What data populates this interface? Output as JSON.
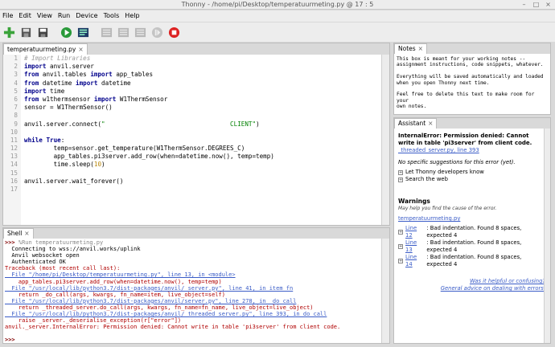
{
  "window": {
    "title": "Thonny  -  /home/pi/Desktop/temperatuurmeting.py  @  17 : 5",
    "controls": [
      "–",
      "□",
      "×"
    ]
  },
  "menu": [
    "File",
    "Edit",
    "View",
    "Run",
    "Device",
    "Tools",
    "Help"
  ],
  "toolbar": {
    "icons": [
      "new-file-icon",
      "open-file-icon",
      "save-file-icon",
      "run-icon",
      "debug-icon",
      "step-over-icon",
      "step-into-icon",
      "step-out-icon",
      "resume-icon",
      "stop-icon"
    ]
  },
  "editor": {
    "tab_label": "temperatuurmeting.py",
    "tab_close": "×",
    "line_numbers": [
      "1",
      "2",
      "3",
      "4",
      "5",
      "6",
      "7",
      "8",
      "9",
      "10",
      "11",
      "12",
      "13",
      "14",
      "15",
      "16",
      "17"
    ]
  },
  "shell": {
    "tab_label": "Shell",
    "tab_close": "×",
    "command_prompt": ">>>",
    "command": " %Run temperatuurmeting.py",
    "output": [
      "  Connecting to wss://anvil.works/uplink",
      "  Anvil websocket open",
      "  Authenticated OK"
    ],
    "traceback_header": "Traceback (most recent call last):",
    "trace": [
      {
        "file": "  File \"/home/pi/Desktop/temperatuurmeting.py\", line 13, in <module>",
        "code": "    app_tables.pi3server.add_row(when=datetime.now(), temp=temp)"
      },
      {
        "file": "  File \"/usr/local/lib/python3.7/dist-packages/anvil/_server.py\", line 41, in item_fn",
        "code": "    return _do_call(args, kwargs, fn_name=item, live_object=self)"
      },
      {
        "file": "  File \"/usr/local/lib/python3.7/dist-packages/anvil/server.py\", line 278, in _do_call",
        "code": "    return _threaded_server.do_call(args, kwargs, fn_name=fn_name, live_object=live_object)"
      },
      {
        "file": "  File \"/usr/local/lib/python3.7/dist-packages/anvil/_threaded_server.py\", line 393, in do_call",
        "code": "    raise _server._deserialise_exception(r[\"error\"])"
      }
    ],
    "error_line": "anvil._server.InternalError: Permission denied: Cannot write in table 'pi3server' from client code.",
    "final_prompt": ">>>"
  },
  "notes": {
    "tab_label": "Notes",
    "tab_close": "×",
    "lines": [
      "This box is meant for your working notes --",
      "assignment instructions, code snippets, whatever.",
      "",
      "Everything will be saved automatically and loaded",
      "when you open Thonny next time.",
      "",
      "Feel free to delete this text to make room for your",
      "own notes."
    ]
  },
  "assistant": {
    "tab_label": "Assistant",
    "tab_close": "×",
    "error_title": "InternalError: Permission denied: Cannot write in table 'pi3server' from client code.",
    "error_link": "_threaded_server.py, line 393",
    "no_suggestions": "No specific suggestions for this error (yet).",
    "options": [
      "Let Thonny developers know",
      "Search the web"
    ],
    "warnings_heading": "Warnings",
    "warnings_sub": "May help you find the cause of the error.",
    "file_link": "temperatuurmeting.py",
    "warnings": [
      {
        "link": "Line 12",
        "text": ": Bad indentation. Found 8 spaces, expected 4"
      },
      {
        "link": "Line 13",
        "text": ": Bad indentation. Found 8 spaces, expected 4"
      },
      {
        "link": "Line 14",
        "text": ": Bad indentation. Found 8 spaces, expected 4"
      }
    ],
    "feedback_link": "Was it helpful or confusing?",
    "advice_link": "General advice on dealing with errors."
  }
}
